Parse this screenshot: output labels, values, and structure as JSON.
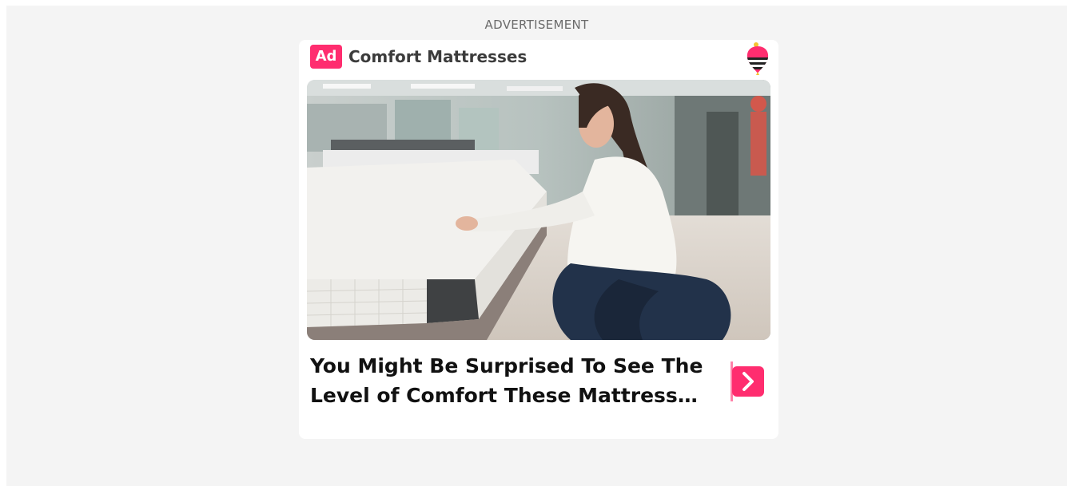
{
  "advertisement_label": "ADVERTISEMENT",
  "card": {
    "badge": "Ad",
    "brand": "Comfort Mattresses",
    "headline": "You Might Be Surprised To See The Level of Comfort These Mattresses Provide",
    "hero_image": "woman-testing-mattress-photo",
    "cta_icon": "chevron-right-icon",
    "logo_icon": "striped-balloon-logo-icon"
  },
  "colors": {
    "accent": "#ff2d6f",
    "page_background": "#f4f4f4",
    "card_background": "#ffffff",
    "headline_text": "#111111"
  }
}
